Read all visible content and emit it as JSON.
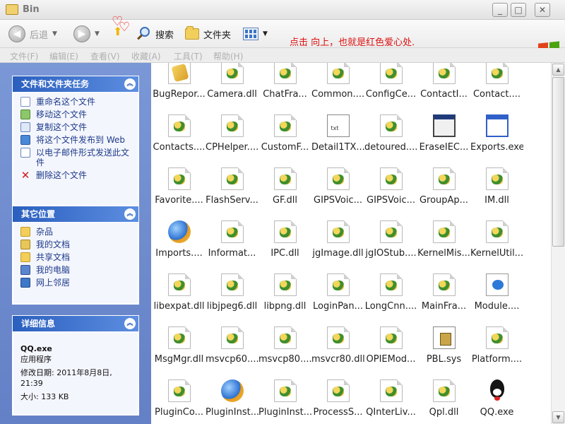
{
  "window": {
    "title": "Bin"
  },
  "toolbar": {
    "back_label": "后退",
    "search_label": "搜索",
    "folders_label": "文件夹",
    "note": "点击  向上，也就是红色爱心处."
  },
  "menu": [
    "文件(F)",
    "编辑(E)",
    "查看(V)",
    "收藏(A)",
    "工具(T)",
    "帮助(H)"
  ],
  "sidebar": {
    "file_tasks": {
      "title": "文件和文件夹任务",
      "items": [
        {
          "label": "重命名这个文件",
          "icon": "rename-icon"
        },
        {
          "label": "移动这个文件",
          "icon": "move-icon"
        },
        {
          "label": "复制这个文件",
          "icon": "copy-icon"
        },
        {
          "label": "将这个文件发布到 Web",
          "icon": "web-publish-icon"
        },
        {
          "label": "以电子邮件形式发送此文件",
          "icon": "email-icon"
        },
        {
          "label": "删除这个文件",
          "icon": "delete-icon"
        }
      ]
    },
    "other_places": {
      "title": "其它位置",
      "items": [
        {
          "label": "杂品",
          "icon": "folder-icon"
        },
        {
          "label": "我的文档",
          "icon": "my-documents-icon"
        },
        {
          "label": "共享文档",
          "icon": "shared-documents-icon"
        },
        {
          "label": "我的电脑",
          "icon": "my-computer-icon"
        },
        {
          "label": "网上邻居",
          "icon": "network-places-icon"
        }
      ]
    },
    "details": {
      "title": "详细信息",
      "name": "QQ.exe",
      "type": "应用程序",
      "modified": "修改日期: 2011年8月8日, 21:39",
      "size": "大小: 133 KB"
    }
  },
  "files": [
    {
      "name": "BugRepor...",
      "icon": "reg"
    },
    {
      "name": "Camera.dll",
      "icon": "dll"
    },
    {
      "name": "ChatFra...",
      "icon": "dll"
    },
    {
      "name": "Common....",
      "icon": "dll"
    },
    {
      "name": "ConfigCe...",
      "icon": "dll"
    },
    {
      "name": "ContactI...",
      "icon": "dll"
    },
    {
      "name": "Contact....",
      "icon": "dll"
    },
    {
      "name": "Contacts....",
      "icon": "dll"
    },
    {
      "name": "CPHelper....",
      "icon": "dll"
    },
    {
      "name": "CustomF...",
      "icon": "dll"
    },
    {
      "name": "Detail1TX...",
      "icon": "txt"
    },
    {
      "name": "detoured....",
      "icon": "dll"
    },
    {
      "name": "EraseIEC...",
      "icon": "exe2"
    },
    {
      "name": "Exports.exe",
      "icon": "exe"
    },
    {
      "name": "Favorite....",
      "icon": "dll"
    },
    {
      "name": "FlashServ...",
      "icon": "dll"
    },
    {
      "name": "GF.dll",
      "icon": "dll"
    },
    {
      "name": "GIPSVoic...",
      "icon": "dll"
    },
    {
      "name": "GIPSVoic...",
      "icon": "dll"
    },
    {
      "name": "GroupAp...",
      "icon": "dll"
    },
    {
      "name": "IM.dll",
      "icon": "dll"
    },
    {
      "name": "Imports....",
      "icon": "globe"
    },
    {
      "name": "Informat...",
      "icon": "dll"
    },
    {
      "name": "IPC.dll",
      "icon": "dll"
    },
    {
      "name": "jgImage.dll",
      "icon": "dll"
    },
    {
      "name": "jgIOStub....",
      "icon": "dll"
    },
    {
      "name": "KernelMis...",
      "icon": "dll"
    },
    {
      "name": "KernelUtil....",
      "icon": "dll"
    },
    {
      "name": "libexpat.dll",
      "icon": "dll"
    },
    {
      "name": "libjpeg6.dll",
      "icon": "dll"
    },
    {
      "name": "libpng.dll",
      "icon": "dll"
    },
    {
      "name": "LoginPan...",
      "icon": "dll"
    },
    {
      "name": "LongCnn....",
      "icon": "dll"
    },
    {
      "name": "MainFra...",
      "icon": "dll"
    },
    {
      "name": "Module....",
      "icon": "cfg"
    },
    {
      "name": "MsgMgr.dll",
      "icon": "dll"
    },
    {
      "name": "msvcp60....",
      "icon": "dll"
    },
    {
      "name": "msvcp80....",
      "icon": "dll"
    },
    {
      "name": "msvcr80.dll",
      "icon": "dll"
    },
    {
      "name": "OPIEMod...",
      "icon": "dll"
    },
    {
      "name": "PBL.sys",
      "icon": "sys"
    },
    {
      "name": "Platform....",
      "icon": "dll"
    },
    {
      "name": "PluginCo...",
      "icon": "dll"
    },
    {
      "name": "PluginInst...",
      "icon": "globe"
    },
    {
      "name": "PluginInst...",
      "icon": "dll"
    },
    {
      "name": "ProcessS...",
      "icon": "dll"
    },
    {
      "name": "QInterLiv...",
      "icon": "dll"
    },
    {
      "name": "Qpl.dll",
      "icon": "dll"
    },
    {
      "name": "QQ.exe",
      "icon": "qq"
    }
  ]
}
